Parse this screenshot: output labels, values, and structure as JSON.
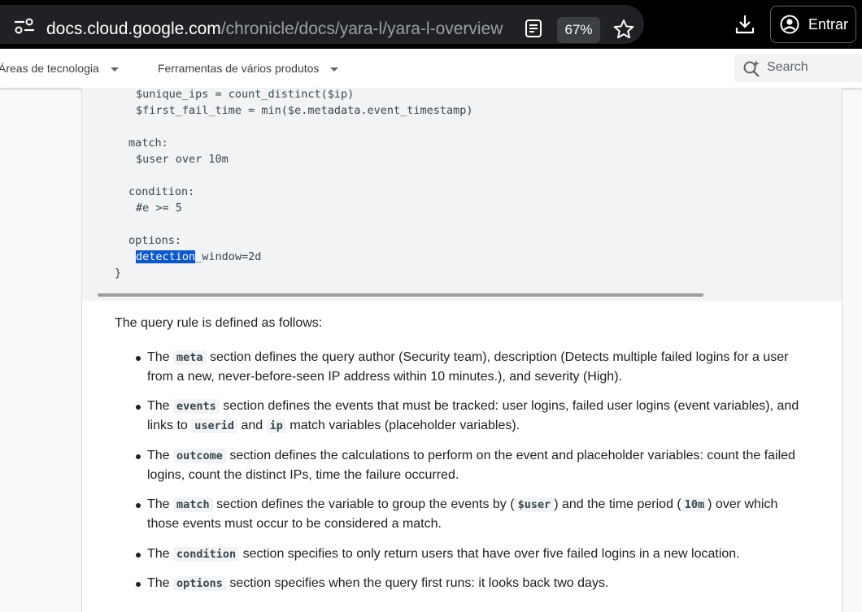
{
  "browser": {
    "url_host": "docs.cloud.google.com",
    "url_path": "/chronicle/docs/yara-l/yara-l-overview",
    "zoom": "67%",
    "signin_label": "Entrar"
  },
  "nav": {
    "items": [
      {
        "label": "Áreas de tecnologia"
      },
      {
        "label": "Ferramentas de vários produtos"
      }
    ],
    "search_placeholder": "Search"
  },
  "code": {
    "lines": [
      "$unique_ips = count_distinct($ip)",
      "$first_fail_time = min($e.metadata.event_timestamp)",
      "match:",
      "$user over 10m",
      "condition:",
      "#e >= 5",
      "options:",
      "_window=2d",
      "}"
    ],
    "highlighted_word": "detection"
  },
  "content": {
    "intro": "The query rule is defined as follows:",
    "bullets": [
      {
        "pre": "The",
        "code": "meta",
        "text1": "section defines the query author (Security team), description (Detects multiple failed logins for a user",
        "text2": "from a new, never-before-seen IP address within 10 minutes.), and severity (High)."
      },
      {
        "pre": "The",
        "code": "events",
        "text1": "section defines the events that must be tracked: user logins, failed user logins (event variables), and",
        "line2_pre": "links to",
        "code2": "userid",
        "and": "and",
        "code3": "ip",
        "line2_post": "match variables (placeholder variables)."
      },
      {
        "pre": "The",
        "code": "outcome",
        "text1": "section defines the calculations to perform on the event and placeholder variables: count the failed",
        "text2": "logins, count the distinct IPs, time the failure occurred."
      },
      {
        "pre": "The",
        "code": "match",
        "text1": "section defines the variable to group the events by (",
        "code2": "$user",
        "text1b": ") and the time period (",
        "code3": "10m",
        "text1c": ") over which",
        "text2": "those events must occur to be considered a match."
      },
      {
        "pre": "The",
        "code": "condition",
        "text1": "section specifies to only return users that have over five failed logins in a new location."
      },
      {
        "pre": "The",
        "code": "options",
        "text1": "section specifies when the query first runs: it looks back two days."
      }
    ]
  }
}
